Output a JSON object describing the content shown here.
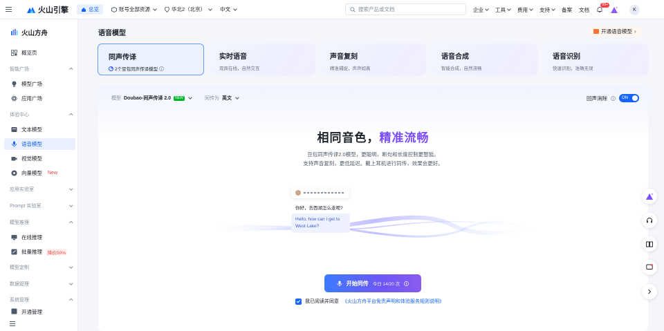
{
  "topbar": {
    "brand": "火山引擎",
    "home_label": "总览",
    "account": "账号全部资源",
    "region": "华北2（北京）",
    "language": "中文",
    "search_placeholder": "搜索产品或文档",
    "nav": [
      "企业",
      "工具",
      "费用",
      "支持",
      "备案",
      "文档"
    ],
    "notif_badge": "99+",
    "avatar_letter": "K"
  },
  "sidebar": {
    "brand": "火山方舟",
    "overview": "概览页",
    "groups": {
      "model_plaza": "智能广场",
      "experience": "体验中心",
      "app_lab": "应用实验室",
      "prompt_lab": "Prompt 实验室",
      "inference": "模型推理",
      "customize": "模型定制",
      "data": "数据管理",
      "system": "系统管理"
    },
    "items": {
      "model_square": "模型广场",
      "app_square": "应用广场",
      "text_model": "文本模型",
      "voice_model": "语音模型",
      "vision_model": "视觉模型",
      "vector_model": "向量模型",
      "online_inference": "在线推理",
      "batch_inference": "批量推理",
      "system_cut": "开通管理"
    },
    "vector_tag": "New",
    "batch_tag": "降价50%"
  },
  "main": {
    "title": "语音模型",
    "open_button": "开通语音模型",
    "cards": [
      {
        "title": "同声传译",
        "sub": "2个豆包同声传译模型"
      },
      {
        "title": "实时语音",
        "sub": "双商在线，自然交互"
      },
      {
        "title": "声音复刻",
        "sub": "精准捕捉，声声如真"
      },
      {
        "title": "语音合成",
        "sub": "智能合成，自然流畅"
      },
      {
        "title": "语音识别",
        "sub": "快速识别，准确无误"
      }
    ],
    "model_label": "模型",
    "model_value": "Doubao-同声传译 2.0",
    "model_badge": "NEW",
    "trans_label": "同传为",
    "trans_value": "英文",
    "echo_label": "回声消除",
    "toggle_label": "ON",
    "hero_prefix": "相同音色，",
    "hero_accent": "精准流畅",
    "desc_line1": "豆包同声传译2.0模型，更聪明，断句和长度控制更智能。",
    "desc_line2": "支持声音复刻，更低延迟。戴上耳机进行同传，效果会更好。",
    "demo_zh": "你好，去西湖怎么走呢?",
    "demo_en": "Hello, how can I get to West Lake?",
    "start_label": "开始同传",
    "start_count": "今日 14/20 次",
    "agree_text": "我已阅读并同意",
    "agree_link": "《火山方舟平台免责声明和体验服务规则说明》"
  },
  "colors": {
    "accent": "#1664ff",
    "purple": "#7a4dff",
    "danger": "#f53f3f"
  }
}
